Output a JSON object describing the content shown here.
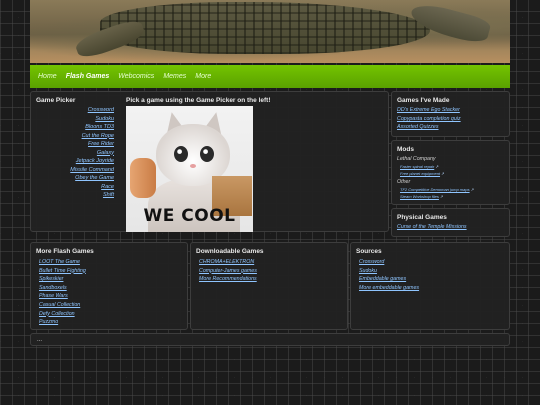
{
  "nav": [
    "Home",
    "Flash Games",
    "Webcomics",
    "Memes",
    "More"
  ],
  "nav_active": "Flash Games",
  "picker": {
    "title": "Game Picker",
    "games": [
      "Crossword",
      "Sudoku",
      "Bloons TD3",
      "Cut the Rope",
      "Free Rider",
      "Galaxy",
      "Jetpack Joyride",
      "Missile Command",
      "Obey the Game",
      "Race",
      "Shift"
    ],
    "prompt": "Pick a game using the Game Picker on the left!",
    "meme_caption": "WE COOL"
  },
  "made": {
    "title": "Games I've Made",
    "items": [
      "DD's Extreme Ego Stacker",
      "Copypasta completion quiz",
      "Assorted Quizzes"
    ]
  },
  "mods": {
    "title": "Mods",
    "groups": [
      {
        "name": "Lethal Company",
        "items": [
          "Faster spinal repair",
          "Free planet equipment"
        ]
      },
      {
        "name": "Other",
        "items": [
          "TF2 Competitive Demoman jump maps",
          "Steam Workshop files"
        ]
      }
    ]
  },
  "physical": {
    "title": "Physical Games",
    "items": [
      "Curse of the Temple Missions"
    ]
  },
  "more_flash": {
    "title": "More Flash Games",
    "items": [
      "LOOT The Game",
      "Bullet Time Fighting",
      "Spikeskier",
      "Sandboxels",
      "Phase Wars",
      "Casual Collection",
      "Defy Collection",
      "Puzzmo"
    ]
  },
  "downloadable": {
    "title": "Downloadable Games",
    "items": [
      "CHROMA+ELEKTRON",
      "Computer-James games",
      "More Recommendations"
    ]
  },
  "sources": {
    "title": "Sources",
    "items": [
      "Crossword",
      "Sudoku",
      "Embeddable games",
      "More embeddable games"
    ]
  },
  "footer": "..."
}
